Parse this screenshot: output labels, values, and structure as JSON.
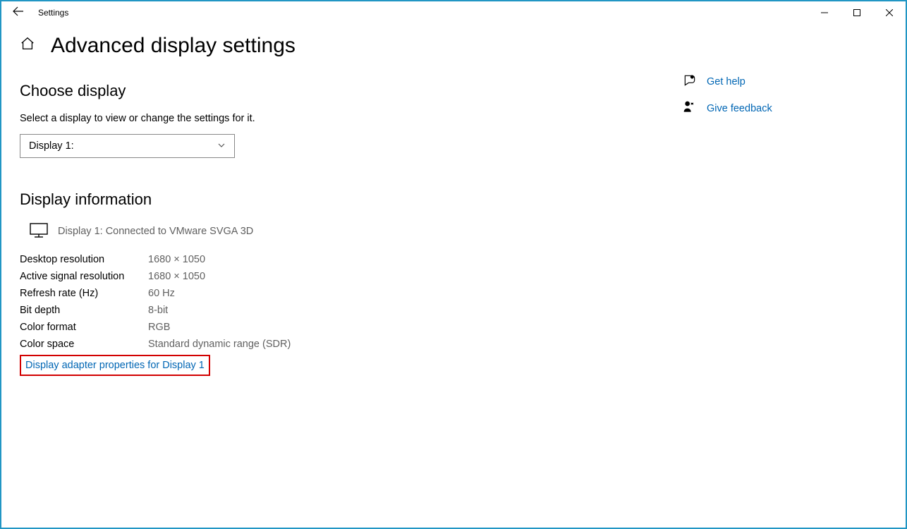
{
  "titlebar": {
    "title": "Settings"
  },
  "page": {
    "heading": "Advanced display settings"
  },
  "choose": {
    "heading": "Choose display",
    "subtext": "Select a display to view or change the settings for it.",
    "selected": "Display 1:"
  },
  "info": {
    "heading": "Display information",
    "monitor_label": "Display 1: Connected to VMware SVGA 3D",
    "rows": [
      {
        "label": "Desktop resolution",
        "value": "1680 × 1050"
      },
      {
        "label": "Active signal resolution",
        "value": "1680 × 1050"
      },
      {
        "label": "Refresh rate (Hz)",
        "value": "60 Hz"
      },
      {
        "label": "Bit depth",
        "value": "8-bit"
      },
      {
        "label": "Color format",
        "value": "RGB"
      },
      {
        "label": "Color space",
        "value": "Standard dynamic range (SDR)"
      }
    ],
    "adapter_link": "Display adapter properties for Display 1"
  },
  "side": {
    "help": "Get help",
    "feedback": "Give feedback"
  }
}
